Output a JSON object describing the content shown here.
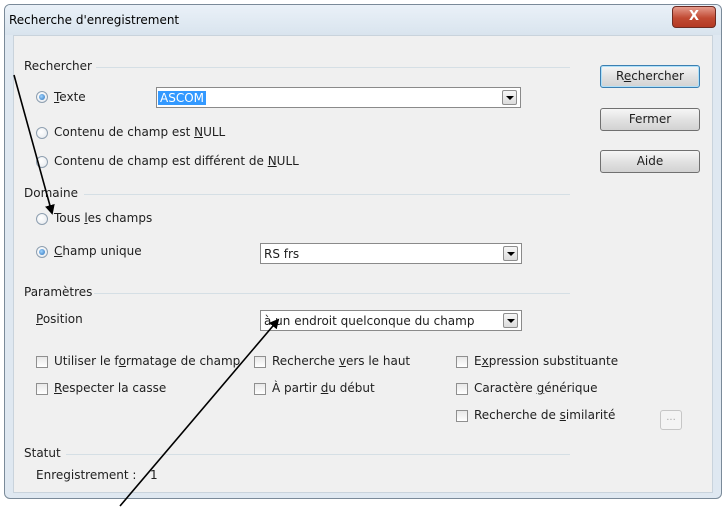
{
  "window": {
    "title": "Recherche d'enregistrement",
    "close_label": "X"
  },
  "search": {
    "section_label": "Rechercher",
    "options": [
      {
        "pre": "",
        "accel": "T",
        "post": "exte",
        "checked": true
      },
      {
        "pre": "Contenu de champ est ",
        "accel": "N",
        "post": "ULL",
        "checked": false
      },
      {
        "pre": "Contenu de champ est différent de ",
        "accel": "N",
        "post": "ULL",
        "checked": false
      }
    ],
    "text_value": "ASCOM"
  },
  "buttons": {
    "search": {
      "pre": "R",
      "accel": "e",
      "post": "chercher"
    },
    "close": "Fermer",
    "help": "Aide"
  },
  "domain": {
    "section_label": "Domaine",
    "all_fields": {
      "pre": "Tous ",
      "accel": "l",
      "post": "es champs",
      "checked": false
    },
    "single_field": {
      "pre": "",
      "accel": "C",
      "post": "hamp unique",
      "checked": true
    },
    "field_value": "RS frs"
  },
  "settings": {
    "section_label": "Paramètres",
    "position": {
      "pre": "",
      "accel": "P",
      "post": "osition",
      "value": "à un endroit quelconque du champ"
    },
    "col1": [
      {
        "pre": "Utiliser le f",
        "accel": "o",
        "post": "rmatage de champ"
      },
      {
        "pre": "",
        "accel": "R",
        "post": "especter la casse"
      }
    ],
    "col2": [
      {
        "pre": "Recherche ",
        "accel": "v",
        "post": "ers le haut"
      },
      {
        "pre": "À partir ",
        "accel": "d",
        "post": "u début"
      }
    ],
    "col3": [
      {
        "pre": "E",
        "accel": "x",
        "post": "pression substituante"
      },
      {
        "pre": "Caractère ",
        "accel": "g",
        "post": "énérique"
      },
      {
        "pre": "Recherche de ",
        "accel": "s",
        "post": "imilarité"
      }
    ],
    "similarity_button": "..."
  },
  "status": {
    "section_label": "Statut",
    "record_label": "Enregistrement :",
    "record_value": "1"
  }
}
